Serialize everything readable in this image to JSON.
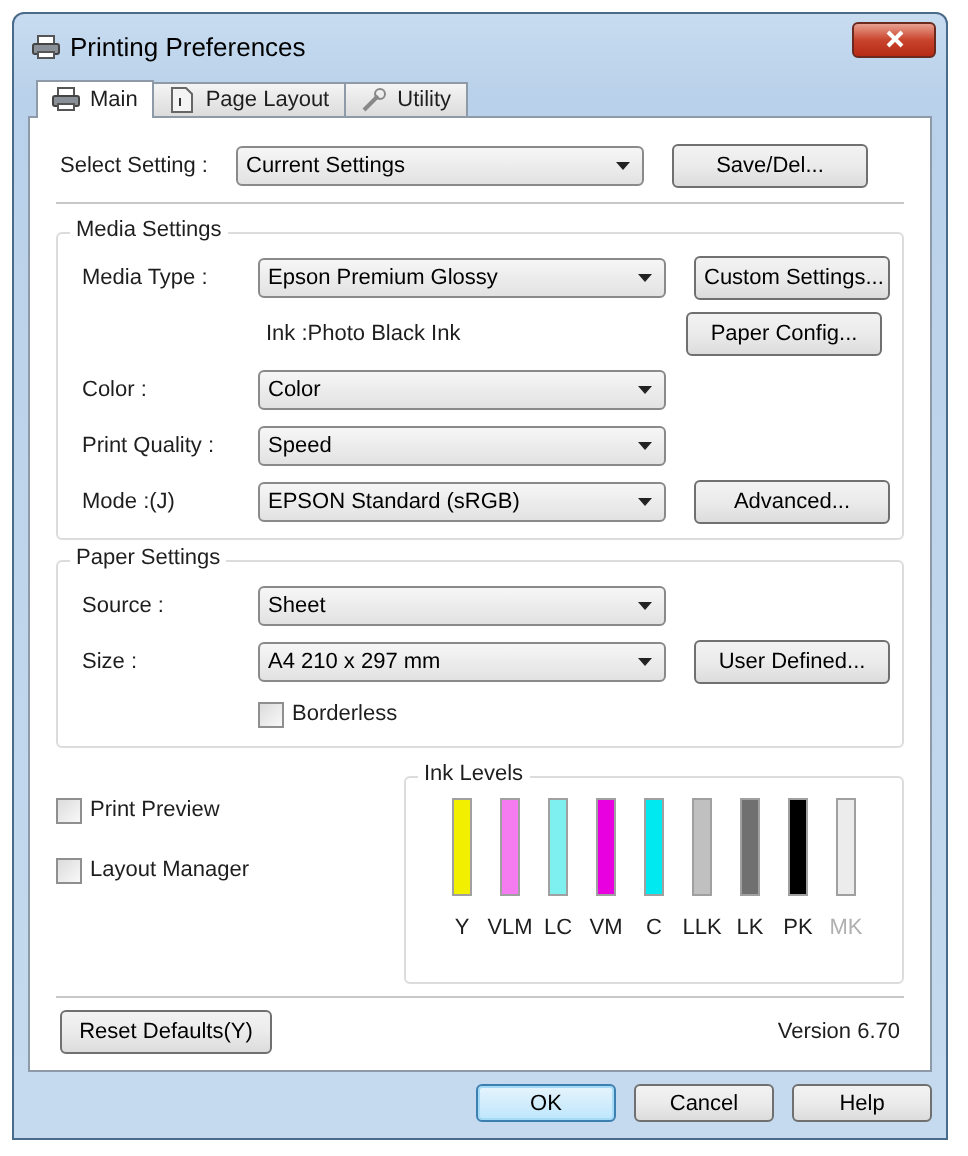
{
  "window": {
    "title": "Printing Preferences"
  },
  "tabs": [
    {
      "kind": "printer",
      "label": "Main",
      "selected": true
    },
    {
      "kind": "page",
      "label": "Page Layout",
      "selected": false
    },
    {
      "kind": "wrench",
      "label": "Utility",
      "selected": false
    }
  ],
  "select_setting": {
    "label": "Select Setting :",
    "value": "Current Settings",
    "button": "Save/Del..."
  },
  "media_settings": {
    "title": "Media Settings",
    "rows": [
      {
        "kind": "combo",
        "label": "Media Type :",
        "value": "Epson Premium Glossy",
        "button": "Custom Settings..."
      },
      {
        "kind": "text",
        "text": "Ink :Photo Black Ink",
        "button": "Paper Config..."
      },
      {
        "kind": "combo",
        "label": "Color :",
        "value": "Color"
      },
      {
        "kind": "combo",
        "label": "Print Quality :",
        "value": "Speed"
      },
      {
        "kind": "combo",
        "label": "Mode :(J)",
        "value": "EPSON Standard (sRGB)",
        "button": "Advanced..."
      }
    ]
  },
  "paper_settings": {
    "title": "Paper Settings",
    "rows": [
      {
        "kind": "combo",
        "label": "Source :",
        "value": "Sheet"
      },
      {
        "kind": "combo",
        "label": "Size :",
        "value": "A4 210 x 297 mm",
        "button": "User Defined..."
      },
      {
        "kind": "checkbox",
        "label": "Borderless",
        "checked": false
      }
    ]
  },
  "options": [
    {
      "label": "Print Preview",
      "checked": false
    },
    {
      "label": "Layout Manager",
      "checked": false
    }
  ],
  "ink_levels": {
    "title": "Ink Levels",
    "inks": [
      {
        "name": "Y",
        "color": "#f2f000",
        "level": 1,
        "disabled": false
      },
      {
        "name": "VLM",
        "color": "#f47cf0",
        "level": 1,
        "disabled": false
      },
      {
        "name": "LC",
        "color": "#7ef0f0",
        "level": 1,
        "disabled": false
      },
      {
        "name": "VM",
        "color": "#e800e0",
        "level": 1,
        "disabled": false
      },
      {
        "name": "C",
        "color": "#00e8f0",
        "level": 1,
        "disabled": false
      },
      {
        "name": "LLK",
        "color": "#c0c0c0",
        "level": 1,
        "disabled": false
      },
      {
        "name": "LK",
        "color": "#707070",
        "level": 1,
        "disabled": false
      },
      {
        "name": "PK",
        "color": "#000000",
        "level": 1,
        "disabled": false
      },
      {
        "name": "MK",
        "color": "#ececec",
        "level": 1,
        "disabled": true
      }
    ]
  },
  "reset_button": "Reset Defaults(Y)",
  "version": "Version 6.70",
  "dialog_buttons": [
    {
      "label": "OK",
      "default": true
    },
    {
      "label": "Cancel",
      "default": false
    },
    {
      "label": "Help",
      "default": false
    }
  ]
}
